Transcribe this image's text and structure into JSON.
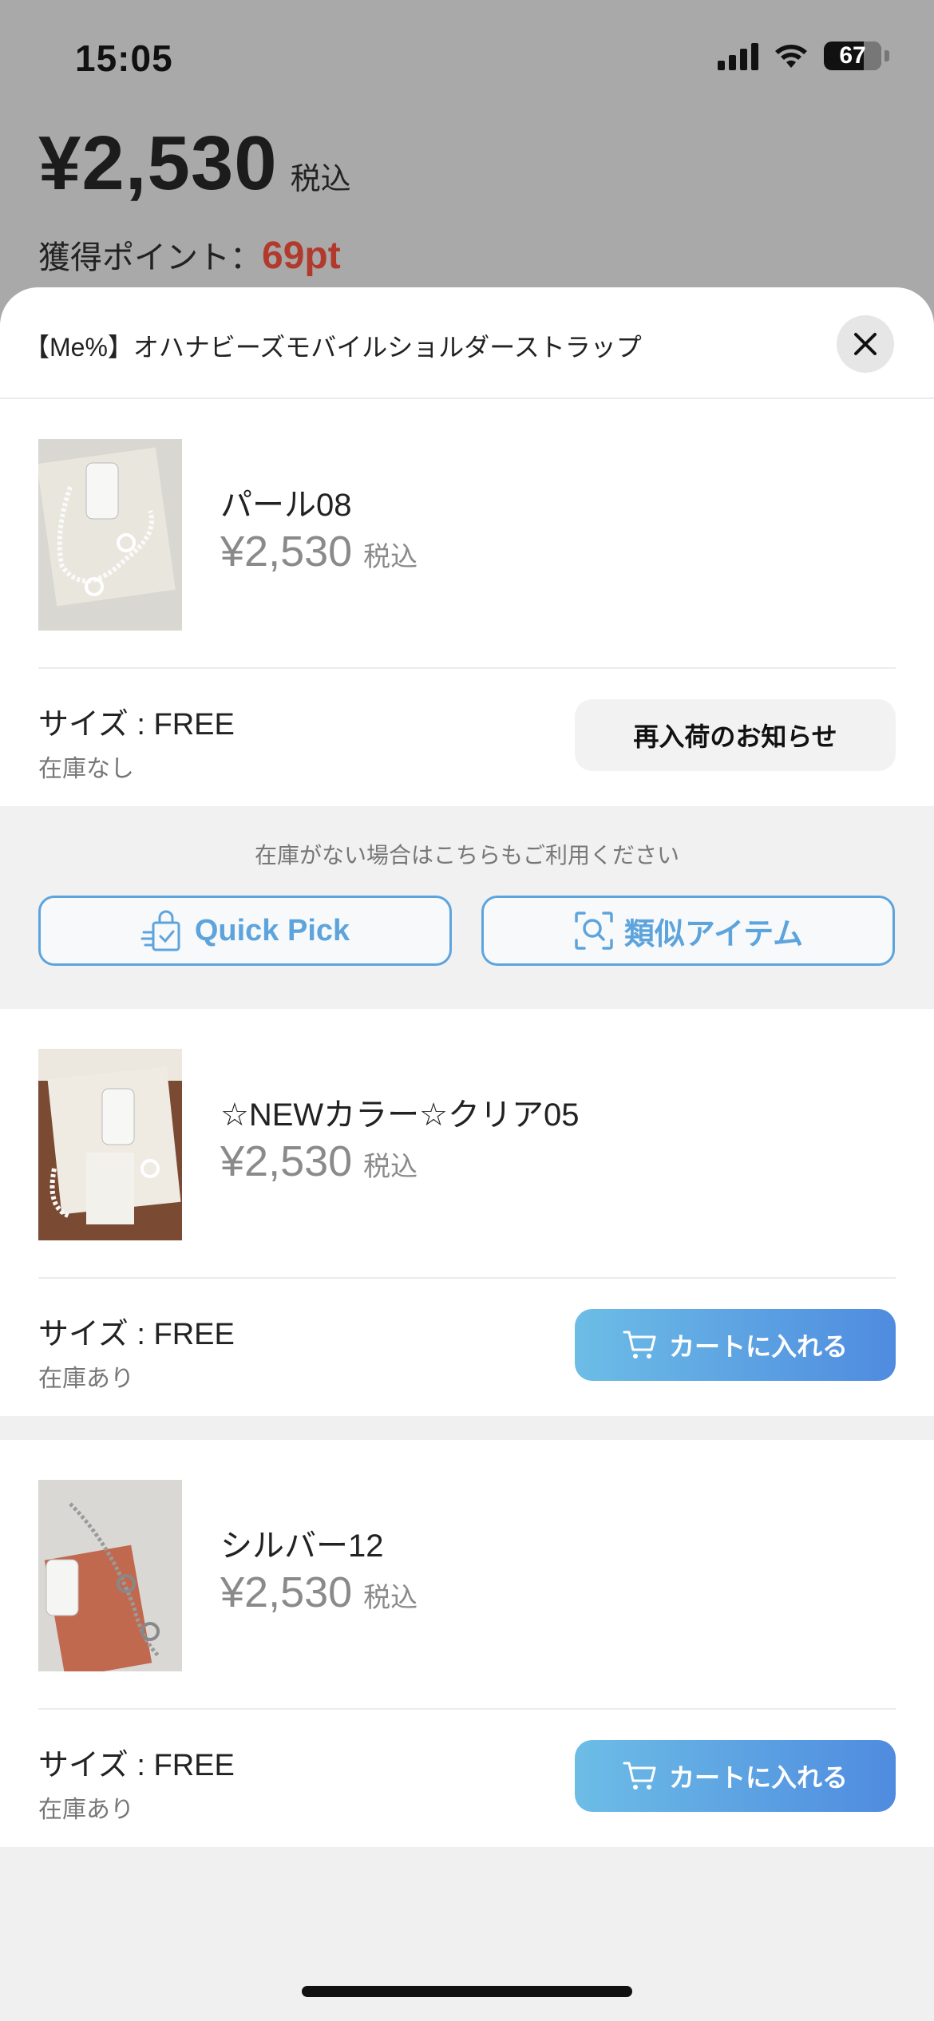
{
  "status_bar": {
    "time": "15:05",
    "battery": "67"
  },
  "background_page": {
    "price": "¥2,530",
    "tax_label": "税込",
    "points_label": "獲得ポイント：",
    "points_value": "69pt"
  },
  "sheet": {
    "title": "【Me%】オハナビーズモバイルショルダーストラップ",
    "close_icon": "close-icon",
    "variants": [
      {
        "name": "パール08",
        "price": "¥2,530",
        "tax": "税込",
        "size": "サイズ : FREE",
        "stock": "在庫なし",
        "action_label": "再入荷のお知らせ",
        "action_type": "restock"
      },
      {
        "name": "☆NEWカラー☆クリア05",
        "price": "¥2,530",
        "tax": "税込",
        "size": "サイズ : FREE",
        "stock": "在庫あり",
        "action_label": "カートに入れる",
        "action_type": "cart"
      },
      {
        "name": "シルバー12",
        "price": "¥2,530",
        "tax": "税込",
        "size": "サイズ : FREE",
        "stock": "在庫あり",
        "action_label": "カートに入れる",
        "action_type": "cart"
      }
    ],
    "out_of_stock_panel": {
      "note": "在庫がない場合はこちらもご利用ください",
      "quick_pick_label": "Quick Pick",
      "similar_items_label": "類似アイテム"
    }
  },
  "colors": {
    "accent_blue": "#5ea4dc",
    "points_red": "#b23a2c",
    "cart_gradient_start": "#6cbde6",
    "cart_gradient_end": "#4f8bdf"
  }
}
